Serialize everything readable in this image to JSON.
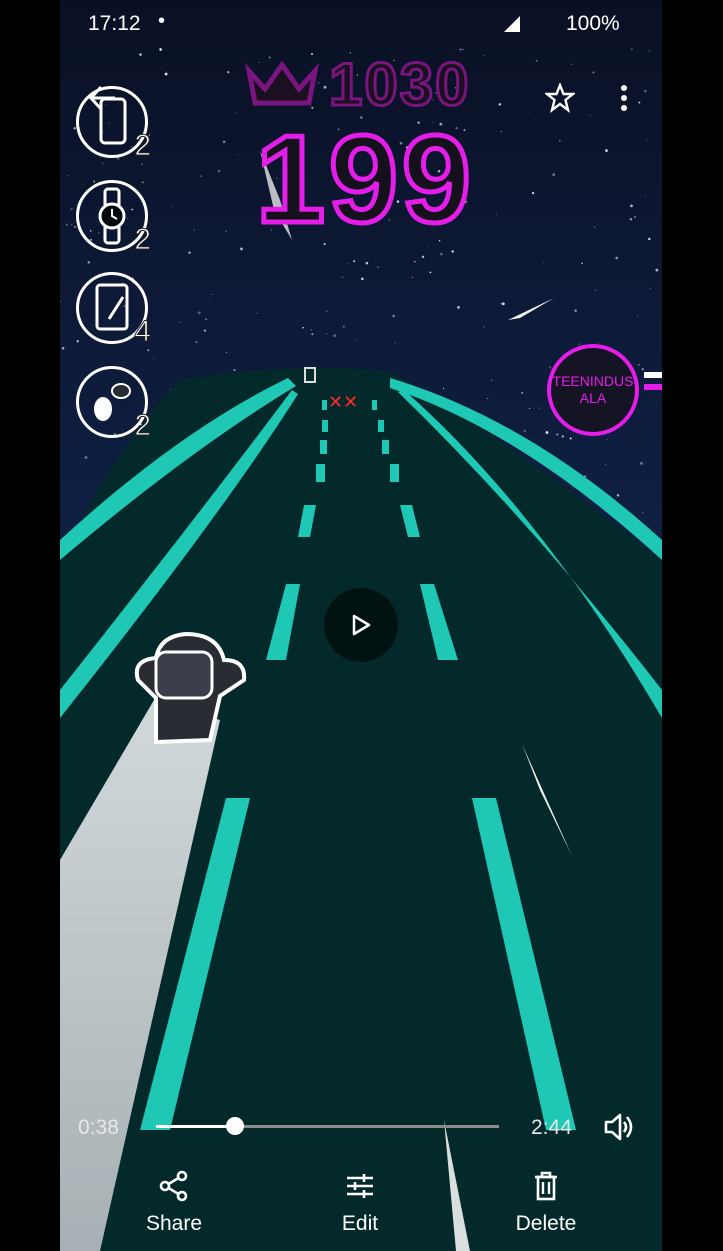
{
  "status_bar": {
    "time": "17:12",
    "battery": "100%"
  },
  "game": {
    "best_score": "1030",
    "current_score": "199",
    "zone_label": "TEENINDUS ALA",
    "powerups": [
      {
        "icon": "phone-icon",
        "count": "2"
      },
      {
        "icon": "watch-icon",
        "count": "2"
      },
      {
        "icon": "tablet-icon",
        "count": "4"
      },
      {
        "icon": "earbuds-icon",
        "count": "2"
      }
    ]
  },
  "player": {
    "elapsed": "0:38",
    "total": "2:44",
    "progress": 0.23
  },
  "actions": {
    "share_label": "Share",
    "edit_label": "Edit",
    "delete_label": "Delete"
  },
  "colors": {
    "road": "#04292a",
    "lane": "#1ec8b4",
    "score_neon": "#e41ee8",
    "sky": "#0b1a33"
  }
}
